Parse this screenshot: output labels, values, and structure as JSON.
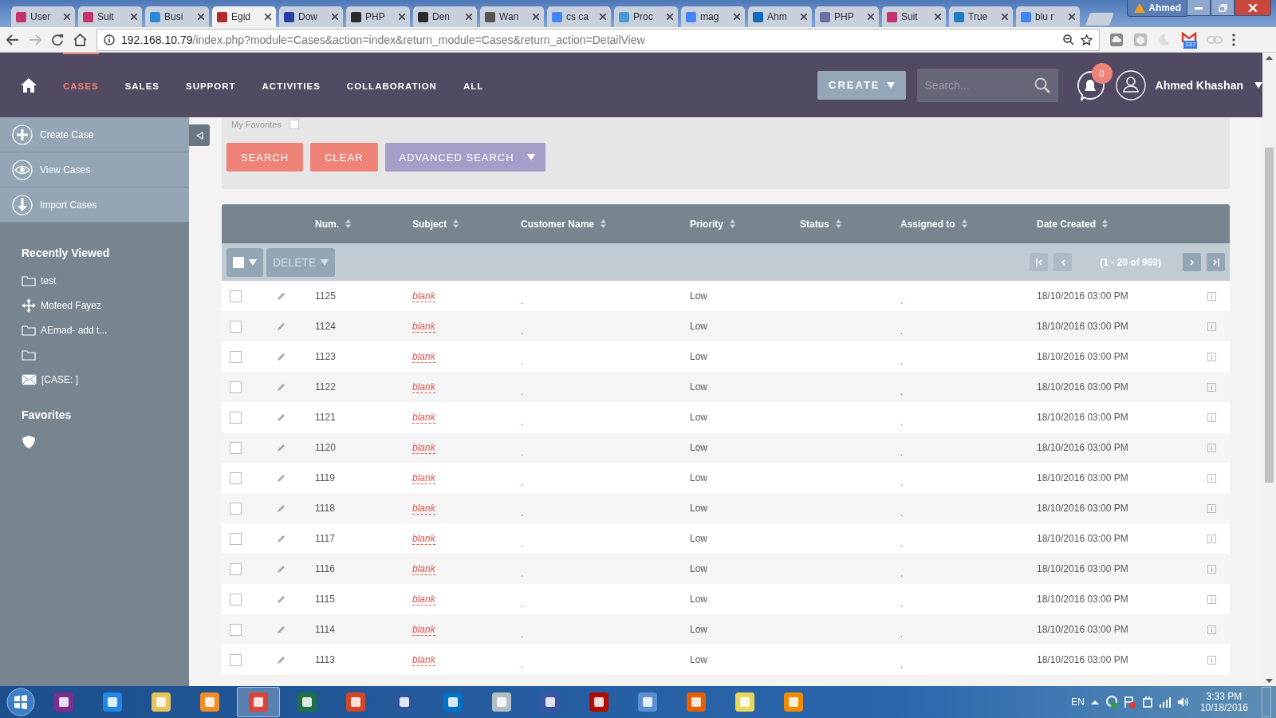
{
  "browser": {
    "tabs": [
      {
        "title": "User",
        "color": "#c2346b",
        "selected": false
      },
      {
        "title": "Suit",
        "color": "#c2346b",
        "selected": false
      },
      {
        "title": "Busi",
        "color": "#2a8ad6",
        "selected": false
      },
      {
        "title": "Egid",
        "color": "#b32a2a",
        "selected": true
      },
      {
        "title": "Dow",
        "color": "#2440a0",
        "selected": false
      },
      {
        "title": "PHP",
        "color": "#2b2b2b",
        "selected": false
      },
      {
        "title": "Den",
        "color": "#2b2b2b",
        "selected": false
      },
      {
        "title": "Wan",
        "color": "#555555",
        "selected": false
      },
      {
        "title": "cs ca",
        "color": "#4285f4",
        "selected": false
      },
      {
        "title": "Proc",
        "color": "#4a9ad6",
        "selected": false
      },
      {
        "title": "mag",
        "color": "#4285f4",
        "selected": false
      },
      {
        "title": "Ahm",
        "color": "#0f6cbd",
        "selected": false
      },
      {
        "title": "PHP",
        "color": "#6a6fa8",
        "selected": false
      },
      {
        "title": "Suit",
        "color": "#c2346b",
        "selected": false
      },
      {
        "title": "True",
        "color": "#1b7fc6",
        "selected": false
      },
      {
        "title": "blu r",
        "color": "#4285f4",
        "selected": false
      }
    ],
    "profile": "Ahmed",
    "url_host": "192.168.10.79",
    "url_path": "/index.php?module=Cases&action=index&return_module=Cases&return_action=DetailView",
    "mail_badge": "337"
  },
  "nav": {
    "items": [
      {
        "label": "CASES",
        "selected": true
      },
      {
        "label": "SALES",
        "selected": false
      },
      {
        "label": "SUPPORT",
        "selected": false
      },
      {
        "label": "ACTIVITIES",
        "selected": false
      },
      {
        "label": "COLLABORATION",
        "selected": false
      },
      {
        "label": "ALL",
        "selected": false
      }
    ],
    "create": "CREATE",
    "search": {
      "placeholder": "Search..."
    },
    "notifications": "0",
    "user": "Ahmed Khashan"
  },
  "sidebar": {
    "actions": [
      {
        "label": "Create Case",
        "kind": "plus"
      },
      {
        "label": "View Cases",
        "kind": "eye"
      },
      {
        "label": "Import Cases",
        "kind": "import"
      }
    ],
    "recently_viewed": {
      "title": "Recently Viewed",
      "items": [
        {
          "label": "test",
          "kind": "folder"
        },
        {
          "label": "Mofeed Fayez",
          "kind": "move"
        },
        {
          "label": "AEmad- add t...",
          "kind": "folder"
        },
        {
          "kind": "folder"
        },
        {
          "label": "[CASE: ]",
          "kind": "mail"
        }
      ]
    },
    "favorites": {
      "title": "Favorites"
    }
  },
  "filter": {
    "my_favorites": {
      "label": "My Favorites",
      "checked": false
    },
    "buttons": [
      {
        "label": "SEARCH",
        "kind": "search"
      },
      {
        "label": "CLEAR",
        "kind": "clear"
      },
      {
        "label": "ADVANCED SEARCH",
        "kind": "advanced"
      }
    ]
  },
  "table": {
    "columns": [
      "Num.",
      "Subject",
      "Customer Name",
      "Priority",
      "Status",
      "Assigned to",
      "Date Created"
    ],
    "bulk_action": "DELETE",
    "pagination": "(1 - 20 of 969)",
    "rows": [
      {
        "num": "1125",
        "subject": "blank",
        "customer_name": ".",
        "priority": "Low",
        "assigned_to": ".",
        "date_created": "18/10/2016 03:00 PM",
        "checked": false
      },
      {
        "num": "1124",
        "subject": "blank",
        "customer_name": ".",
        "priority": "Low",
        "assigned_to": ".",
        "date_created": "18/10/2016 03:00 PM",
        "checked": false
      },
      {
        "num": "1123",
        "subject": "blank",
        "customer_name": ".",
        "priority": "Low",
        "assigned_to": ".",
        "date_created": "18/10/2016 03:00 PM",
        "checked": false
      },
      {
        "num": "1122",
        "subject": "blank",
        "customer_name": ".",
        "priority": "Low",
        "assigned_to": ".",
        "date_created": "18/10/2016 03:00 PM",
        "checked": false
      },
      {
        "num": "1121",
        "subject": "blank",
        "customer_name": ".",
        "priority": "Low",
        "assigned_to": ".",
        "date_created": "18/10/2016 03:00 PM",
        "checked": false
      },
      {
        "num": "1120",
        "subject": "blank",
        "customer_name": ".",
        "priority": "Low",
        "assigned_to": ".",
        "date_created": "18/10/2016 03:00 PM",
        "checked": false
      },
      {
        "num": "1119",
        "subject": "blank",
        "customer_name": ".",
        "priority": "Low",
        "assigned_to": ".",
        "date_created": "18/10/2016 03:00 PM",
        "checked": false
      },
      {
        "num": "1118",
        "subject": "blank",
        "customer_name": ".",
        "priority": "Low",
        "assigned_to": ".",
        "date_created": "18/10/2016 03:00 PM",
        "checked": false
      },
      {
        "num": "1117",
        "subject": "blank",
        "customer_name": ".",
        "priority": "Low",
        "assigned_to": ".",
        "date_created": "18/10/2016 03:00 PM",
        "checked": false
      },
      {
        "num": "1116",
        "subject": "blank",
        "customer_name": ".",
        "priority": "Low",
        "assigned_to": ".",
        "date_created": "18/10/2016 03:00 PM",
        "checked": false
      },
      {
        "num": "1115",
        "subject": "blank",
        "customer_name": ".",
        "priority": "Low",
        "assigned_to": ".",
        "date_created": "18/10/2016 03:00 PM",
        "checked": false
      },
      {
        "num": "1114",
        "subject": "blank",
        "customer_name": ".",
        "priority": "Low",
        "assigned_to": ".",
        "date_created": "18/10/2016 03:00 PM",
        "checked": false
      },
      {
        "num": "1113",
        "subject": "blank",
        "customer_name": ".",
        "priority": "Low",
        "assigned_to": ".",
        "date_created": "18/10/2016 03:00 PM",
        "checked": false
      }
    ]
  },
  "taskbar": {
    "apps": [
      {
        "kind": "onenote",
        "selected": false
      },
      {
        "kind": "ie",
        "selected": false
      },
      {
        "kind": "explorer",
        "selected": false
      },
      {
        "kind": "media",
        "selected": false
      },
      {
        "kind": "chrome",
        "selected": true
      },
      {
        "kind": "excel",
        "selected": false
      },
      {
        "kind": "powerpoint",
        "selected": false
      },
      {
        "kind": "word",
        "selected": false
      },
      {
        "kind": "outlook",
        "selected": false
      },
      {
        "kind": "calculator",
        "selected": false
      },
      {
        "kind": "visio",
        "selected": false
      },
      {
        "kind": "acrobat",
        "selected": false
      },
      {
        "kind": "remote",
        "selected": false
      },
      {
        "kind": "firefox",
        "selected": false
      },
      {
        "kind": "notes",
        "selected": false
      },
      {
        "kind": "vlc",
        "selected": false
      }
    ],
    "language": "EN",
    "time": "3:33 PM",
    "date": "10/18/2016"
  }
}
